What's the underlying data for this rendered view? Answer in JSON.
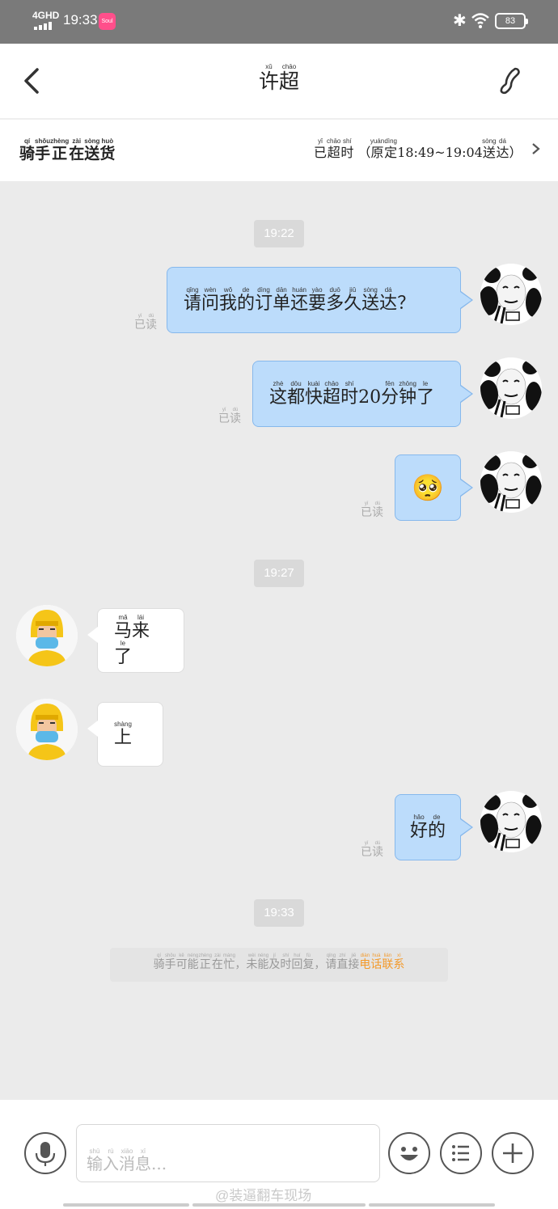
{
  "status_bar": {
    "network": "4GHD",
    "time": "19:33",
    "app_badge": "Soul",
    "battery": "83"
  },
  "header": {
    "title_text": "许超",
    "title_pinyin_1": "xǔ",
    "title_pinyin_2": "chāo"
  },
  "order": {
    "status": [
      [
        "骑",
        "qí"
      ],
      [
        "手",
        "shǒu"
      ],
      [
        "正",
        "zhèng"
      ],
      [
        "在",
        "zài"
      ],
      [
        "送",
        "sòng"
      ],
      [
        "货",
        "huò"
      ]
    ],
    "overtime": [
      [
        "已",
        "yǐ"
      ],
      [
        "超",
        "chāo"
      ],
      [
        "时",
        "shí"
      ]
    ],
    "original_prefix": "（",
    "original_word": [
      [
        "原",
        "yuán"
      ],
      [
        "定",
        "dìng"
      ]
    ],
    "original_range": "18:49~19:04",
    "original_suffix_word": [
      [
        "送",
        "sòng"
      ],
      [
        "达",
        "dá"
      ]
    ],
    "original_close": "）"
  },
  "messages": {
    "time_1": "19:22",
    "msg_1": [
      [
        "请",
        "qǐng"
      ],
      [
        "问",
        "wèn"
      ],
      [
        "我",
        "wǒ"
      ],
      [
        "的",
        "de"
      ],
      [
        "订",
        "dìng"
      ],
      [
        "单",
        "dān"
      ],
      [
        "还",
        "huán"
      ],
      [
        "要",
        "yào"
      ],
      [
        "多",
        "duō"
      ],
      [
        "久",
        "jiǔ"
      ],
      [
        "送",
        "sòng"
      ],
      [
        "达",
        "dá"
      ],
      [
        "？",
        ""
      ]
    ],
    "msg_2": [
      [
        "这",
        "zhè"
      ],
      [
        "都",
        "dōu"
      ],
      [
        "快",
        "kuài"
      ],
      [
        "超",
        "chāo"
      ],
      [
        "时",
        "shí"
      ],
      [
        "20",
        ""
      ],
      [
        "分",
        "fēn"
      ],
      [
        "钟",
        "zhōng"
      ],
      [
        "了",
        "le"
      ]
    ],
    "msg_3_emoji": "🥺",
    "time_2": "19:27",
    "msg_4": [
      [
        "马",
        "mǎ"
      ],
      [
        "来",
        "lái"
      ],
      [
        "了",
        "le"
      ]
    ],
    "msg_5": [
      [
        "上",
        "shàng"
      ]
    ],
    "msg_6": [
      [
        "好",
        "hǎo"
      ],
      [
        "的",
        "de"
      ]
    ],
    "time_3": "19:33",
    "read_label": [
      [
        "已",
        "yǐ"
      ],
      [
        "读",
        "dú"
      ]
    ]
  },
  "system_note": {
    "text": [
      [
        "骑",
        "qí"
      ],
      [
        "手",
        "shǒu"
      ],
      [
        "可",
        "kě"
      ],
      [
        "能",
        "néng"
      ],
      [
        "正",
        "zhèng"
      ],
      [
        "在",
        "zài"
      ],
      [
        "忙",
        "máng"
      ],
      [
        "，",
        ""
      ],
      [
        "未",
        "wèi"
      ],
      [
        "能",
        "néng"
      ],
      [
        "及",
        "jí"
      ],
      [
        "时",
        "shí"
      ],
      [
        "回",
        "huí"
      ],
      [
        "复",
        "fù"
      ],
      [
        "，",
        ""
      ],
      [
        "请",
        "qǐng"
      ],
      [
        "直",
        "zhí"
      ],
      [
        "接",
        "jiē"
      ]
    ],
    "link": [
      [
        "电",
        "diàn"
      ],
      [
        "话",
        "huà"
      ],
      [
        "联",
        "lián"
      ],
      [
        "系",
        "xì"
      ]
    ]
  },
  "input": {
    "placeholder": [
      [
        "输",
        "shū"
      ],
      [
        "入",
        "rù"
      ],
      [
        "消",
        "xiāo"
      ],
      [
        "息",
        "xī"
      ]
    ],
    "ellipsis": "..."
  },
  "watermark": "@装逼翻车现场",
  "colors": {
    "my_bubble": "#bcdcfb",
    "my_bubble_border": "#86b8ec",
    "link_orange": "#f39a2b"
  }
}
